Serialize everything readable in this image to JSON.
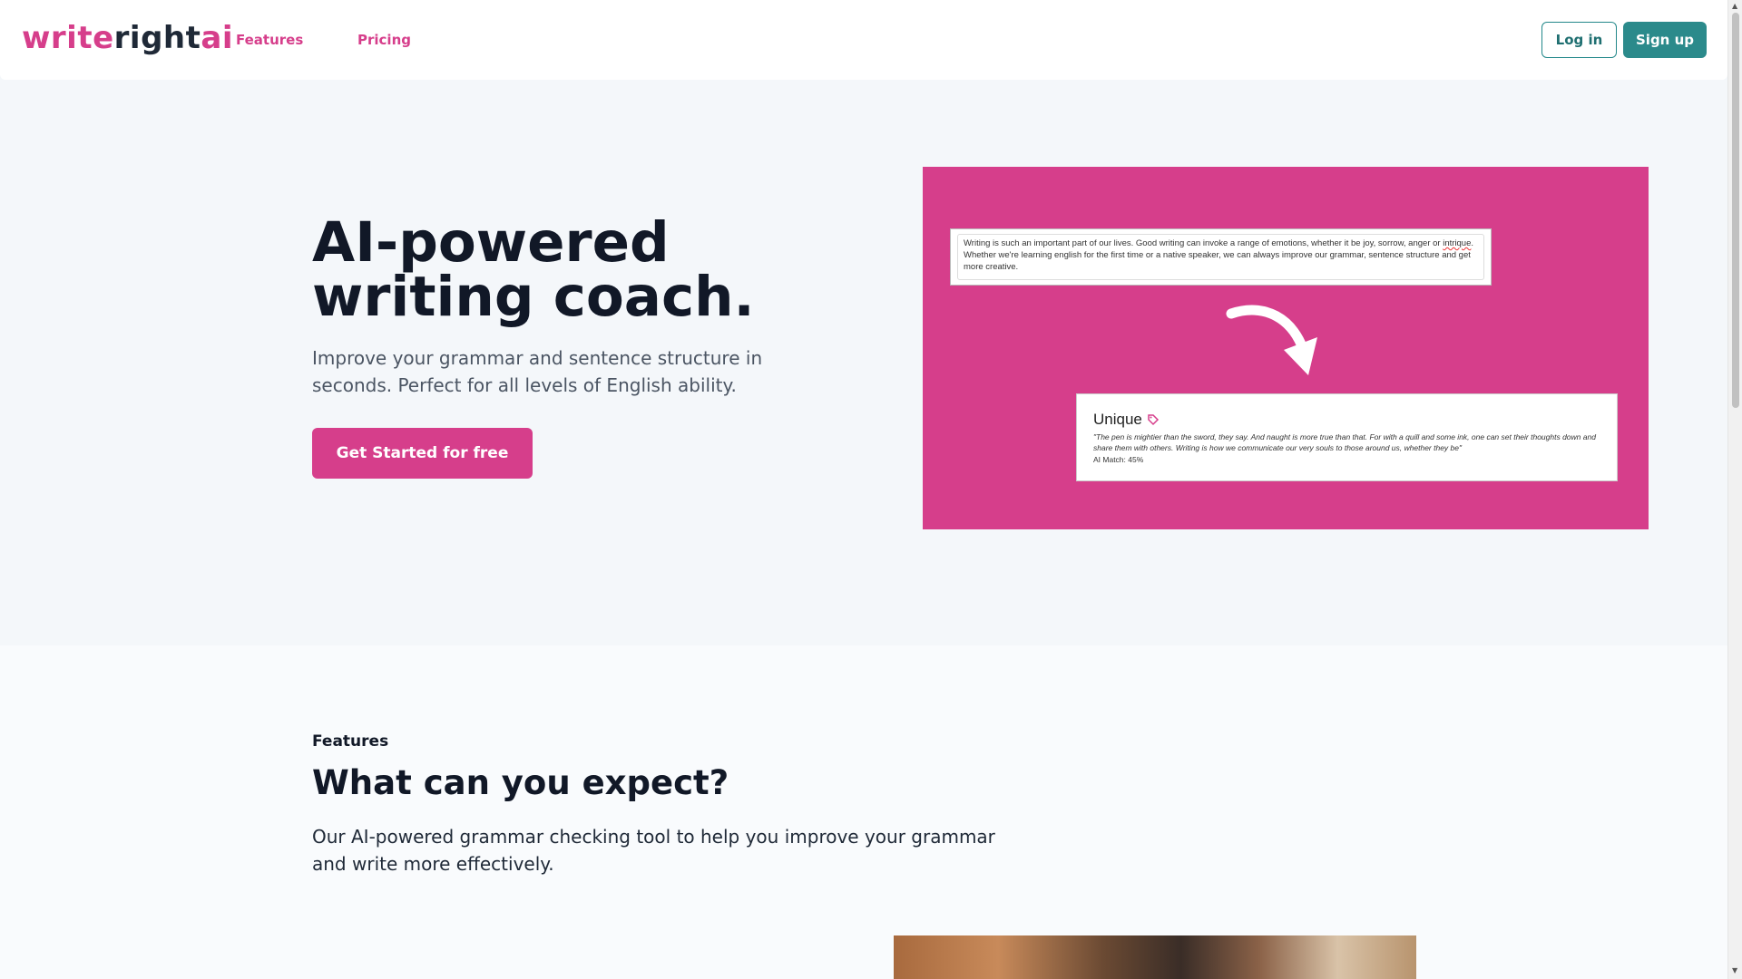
{
  "header": {
    "logo": {
      "part1": "write",
      "part2": "right",
      "part3": "ai"
    },
    "nav": [
      {
        "label": "Features"
      },
      {
        "label": "Pricing"
      }
    ],
    "login_label": "Log in",
    "signup_label": "Sign up"
  },
  "hero": {
    "title_line1": "AI-powered",
    "title_line2": "writing coach.",
    "subtitle": "Improve your grammar and sentence structure in seconds. Perfect for all levels of English ability.",
    "cta_label": "Get Started for free",
    "image": {
      "input_text_before": "Writing is such an important part of our lives. Good writing can invoke a range of emotions, whether it be joy, sorrow, anger or ",
      "input_text_error": "intrique",
      "input_text_after": ". Whether we're learning english for the first time or a native speaker, we can always improve our grammar, sentence structure and get more creative.",
      "result_title": "Unique",
      "result_quote": "\"The pen is mightier than the sword, they say. And naught is more true than that. For with a quill and some ink, one can set their thoughts down and share them with others. Writing is how we communicate our very souls to those around us, whether they be\"",
      "result_match": "AI Match: 45%"
    }
  },
  "features": {
    "eyebrow": "Features",
    "title": "What can you expect?",
    "description": "Our AI-powered grammar checking tool to help you improve your grammar and write more effectively."
  },
  "colors": {
    "brand_pink": "#d63e8b",
    "brand_teal": "#2b8a8b",
    "text_dark": "#111827"
  }
}
